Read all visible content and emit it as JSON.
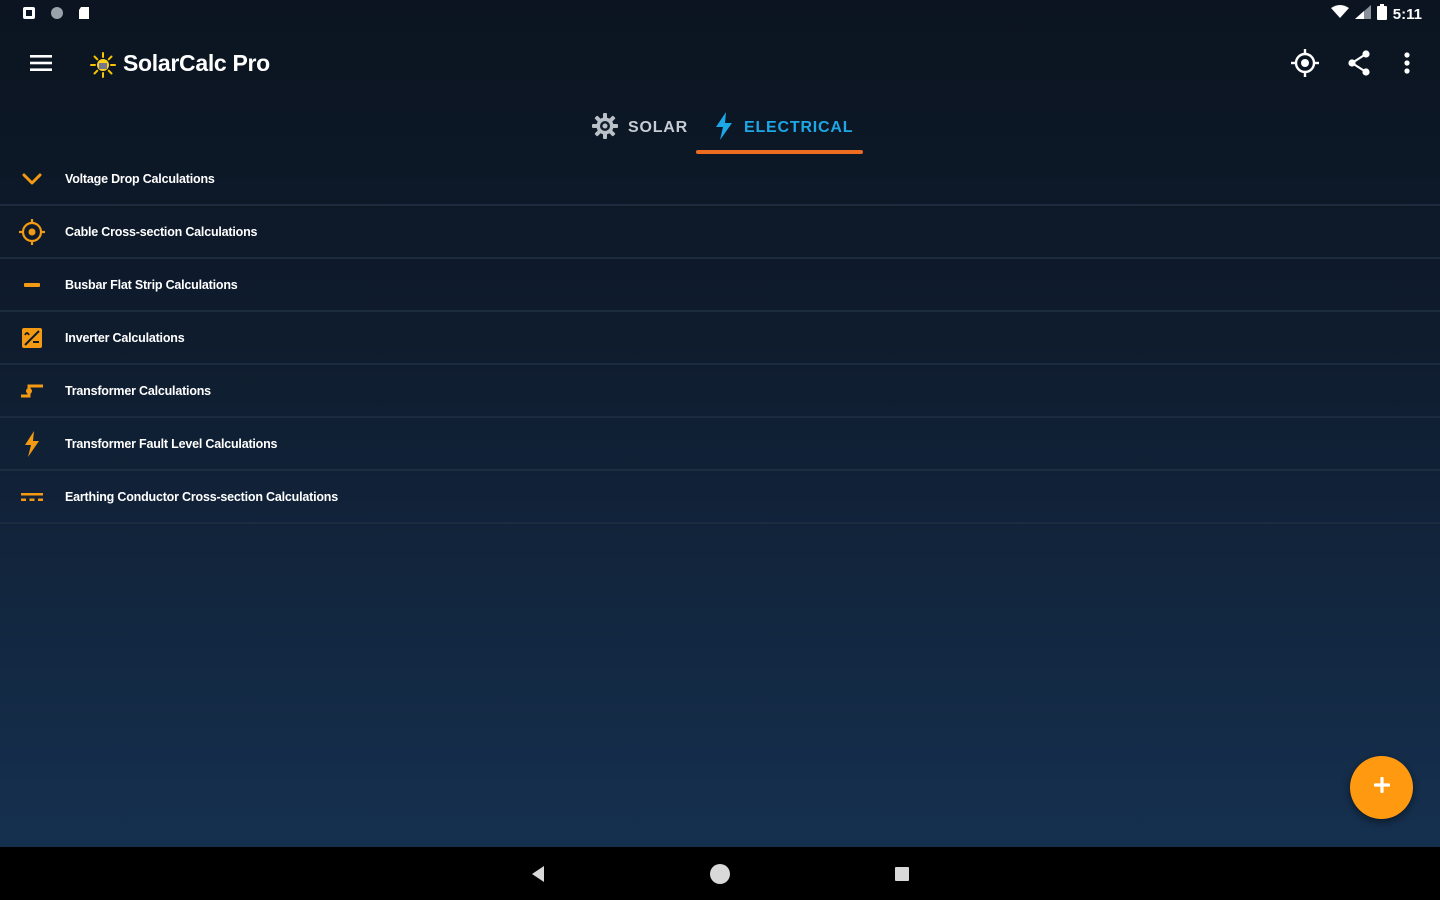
{
  "status_bar": {
    "time": "5:11",
    "left_icons": [
      "notification-app-icon",
      "circle-status-icon",
      "sd-card-icon"
    ],
    "right_icons": [
      "wifi-icon",
      "cell-signal-icon",
      "battery-icon"
    ]
  },
  "app_bar": {
    "title": "SolarCalc Pro",
    "menu_icon": "hamburger-menu-icon",
    "logo_icon": "sun-logo-icon",
    "actions": [
      "locate-icon",
      "share-icon",
      "more-vert-icon"
    ]
  },
  "tabs": [
    {
      "label": "SOLAR",
      "icon": "gear-icon",
      "selected": false
    },
    {
      "label": "ELECTRICAL",
      "icon": "lightning-icon",
      "selected": true
    }
  ],
  "list": {
    "items": [
      {
        "label": "Voltage Drop Calculations",
        "icon": "chevron-down-icon"
      },
      {
        "label": "Cable Cross-section Calculations",
        "icon": "cable-target-icon"
      },
      {
        "label": "Busbar Flat Strip Calculations",
        "icon": "busbar-icon"
      },
      {
        "label": "Inverter Calculations",
        "icon": "inverter-icon"
      },
      {
        "label": "Transformer Calculations",
        "icon": "transformer-icon"
      },
      {
        "label": "Transformer Fault Level Calculations",
        "icon": "fault-bolt-icon"
      },
      {
        "label": "Earthing Conductor Cross-section Calculations",
        "icon": "earthing-icon"
      }
    ]
  },
  "fab": {
    "label": "+",
    "icon": "plus-icon"
  },
  "nav_bar": {
    "buttons": [
      "back-icon",
      "home-icon",
      "recents-icon"
    ]
  },
  "colors": {
    "accent": "#ff9a10",
    "tab_selected": "#1da7e6",
    "tab_indicator": "#ee6b22",
    "background_top": "#0b1420",
    "background_bottom": "#15304f"
  }
}
